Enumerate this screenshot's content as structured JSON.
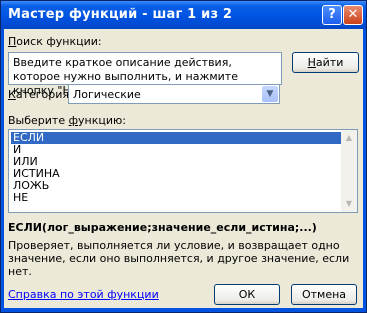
{
  "window": {
    "title": "Мастер функций - шаг 1 из 2",
    "help_glyph": "?",
    "close_glyph": "✕"
  },
  "search": {
    "label_pre": "",
    "label_u": "П",
    "label_post": "оиск функции:",
    "value": "Введите краткое описание действия, которое нужно выполнить, и нажмите кнопку \"Найти\"",
    "find_pre": "",
    "find_u": "Н",
    "find_post": "айти"
  },
  "category": {
    "label_pre": "",
    "label_u": "К",
    "label_post": "атегория:",
    "value": "Логические",
    "dropdown_icon": "chevron-down"
  },
  "functions": {
    "label_pre": "Выберите ",
    "label_u": "ф",
    "label_post": "ункцию:",
    "items": [
      "ЕСЛИ",
      "И",
      "ИЛИ",
      "ИСТИНА",
      "ЛОЖЬ",
      "НЕ"
    ],
    "selected": "ЕСЛИ"
  },
  "selected_function": {
    "syntax": "ЕСЛИ(лог_выражение;значение_если_истина;...)",
    "description": "Проверяет, выполняется ли условие, и возвращает одно значение, если оно выполняется, и другое значение, если нет."
  },
  "footer": {
    "help_link": "Справка по этой функции",
    "ok": "ОК",
    "cancel": "Отмена"
  },
  "colors": {
    "title_bar": "#0054e3",
    "selection": "#316ac5",
    "dialog_bg": "#ece9d8",
    "link": "#0000ff"
  }
}
